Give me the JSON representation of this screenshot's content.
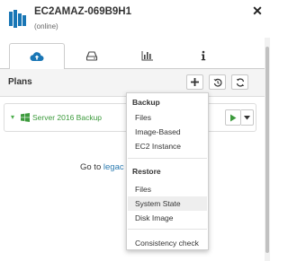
{
  "header": {
    "host_name": "EC2AMAZ-069B9H1",
    "status": "(online)",
    "close_glyph": "✕"
  },
  "tabs": [
    {
      "icon": "cloud-upload-icon",
      "active": true
    },
    {
      "icon": "hard-drive-icon",
      "active": false
    },
    {
      "icon": "bar-chart-icon",
      "active": false
    },
    {
      "icon": "info-icon",
      "active": false
    }
  ],
  "plans": {
    "title": "Plans",
    "buttons": [
      "plus-icon",
      "history-icon",
      "refresh-icon"
    ]
  },
  "plan": {
    "name": "Server 2016 Backup",
    "os_icon": "windows-icon"
  },
  "legacy": {
    "prefix": "Go to",
    "link": "legac"
  },
  "menu": {
    "backup_label": "Backup",
    "backup_items": [
      "Files",
      "Image-Based",
      "EC2 Instance"
    ],
    "restore_label": "Restore",
    "restore_items": [
      "Files",
      "System State",
      "Disk Image"
    ],
    "footer_item": "Consistency check",
    "hovered_item": "System State"
  },
  "colors": {
    "accent_blue": "#1976b5",
    "plan_green": "#3c9a3c",
    "link_blue": "#2a7ab0"
  }
}
